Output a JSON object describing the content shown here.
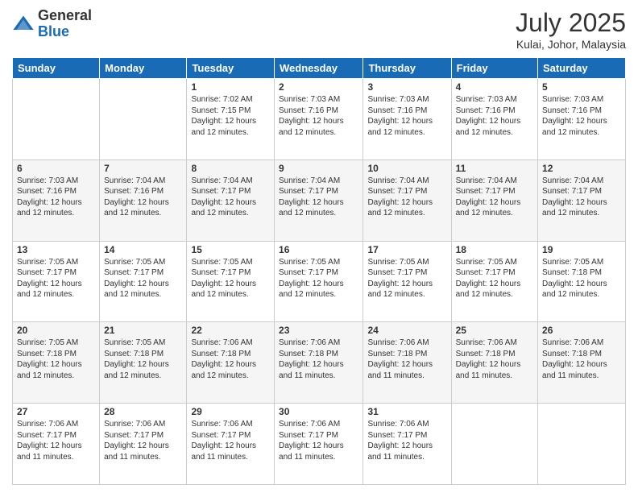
{
  "logo": {
    "general": "General",
    "blue": "Blue"
  },
  "title": "July 2025",
  "location": "Kulai, Johor, Malaysia",
  "days_of_week": [
    "Sunday",
    "Monday",
    "Tuesday",
    "Wednesday",
    "Thursday",
    "Friday",
    "Saturday"
  ],
  "weeks": [
    [
      {
        "day": "",
        "info": ""
      },
      {
        "day": "",
        "info": ""
      },
      {
        "day": "1",
        "info": "Sunrise: 7:02 AM\nSunset: 7:15 PM\nDaylight: 12 hours and 12 minutes."
      },
      {
        "day": "2",
        "info": "Sunrise: 7:03 AM\nSunset: 7:16 PM\nDaylight: 12 hours and 12 minutes."
      },
      {
        "day": "3",
        "info": "Sunrise: 7:03 AM\nSunset: 7:16 PM\nDaylight: 12 hours and 12 minutes."
      },
      {
        "day": "4",
        "info": "Sunrise: 7:03 AM\nSunset: 7:16 PM\nDaylight: 12 hours and 12 minutes."
      },
      {
        "day": "5",
        "info": "Sunrise: 7:03 AM\nSunset: 7:16 PM\nDaylight: 12 hours and 12 minutes."
      }
    ],
    [
      {
        "day": "6",
        "info": "Sunrise: 7:03 AM\nSunset: 7:16 PM\nDaylight: 12 hours and 12 minutes."
      },
      {
        "day": "7",
        "info": "Sunrise: 7:04 AM\nSunset: 7:16 PM\nDaylight: 12 hours and 12 minutes."
      },
      {
        "day": "8",
        "info": "Sunrise: 7:04 AM\nSunset: 7:17 PM\nDaylight: 12 hours and 12 minutes."
      },
      {
        "day": "9",
        "info": "Sunrise: 7:04 AM\nSunset: 7:17 PM\nDaylight: 12 hours and 12 minutes."
      },
      {
        "day": "10",
        "info": "Sunrise: 7:04 AM\nSunset: 7:17 PM\nDaylight: 12 hours and 12 minutes."
      },
      {
        "day": "11",
        "info": "Sunrise: 7:04 AM\nSunset: 7:17 PM\nDaylight: 12 hours and 12 minutes."
      },
      {
        "day": "12",
        "info": "Sunrise: 7:04 AM\nSunset: 7:17 PM\nDaylight: 12 hours and 12 minutes."
      }
    ],
    [
      {
        "day": "13",
        "info": "Sunrise: 7:05 AM\nSunset: 7:17 PM\nDaylight: 12 hours and 12 minutes."
      },
      {
        "day": "14",
        "info": "Sunrise: 7:05 AM\nSunset: 7:17 PM\nDaylight: 12 hours and 12 minutes."
      },
      {
        "day": "15",
        "info": "Sunrise: 7:05 AM\nSunset: 7:17 PM\nDaylight: 12 hours and 12 minutes."
      },
      {
        "day": "16",
        "info": "Sunrise: 7:05 AM\nSunset: 7:17 PM\nDaylight: 12 hours and 12 minutes."
      },
      {
        "day": "17",
        "info": "Sunrise: 7:05 AM\nSunset: 7:17 PM\nDaylight: 12 hours and 12 minutes."
      },
      {
        "day": "18",
        "info": "Sunrise: 7:05 AM\nSunset: 7:17 PM\nDaylight: 12 hours and 12 minutes."
      },
      {
        "day": "19",
        "info": "Sunrise: 7:05 AM\nSunset: 7:18 PM\nDaylight: 12 hours and 12 minutes."
      }
    ],
    [
      {
        "day": "20",
        "info": "Sunrise: 7:05 AM\nSunset: 7:18 PM\nDaylight: 12 hours and 12 minutes."
      },
      {
        "day": "21",
        "info": "Sunrise: 7:05 AM\nSunset: 7:18 PM\nDaylight: 12 hours and 12 minutes."
      },
      {
        "day": "22",
        "info": "Sunrise: 7:06 AM\nSunset: 7:18 PM\nDaylight: 12 hours and 12 minutes."
      },
      {
        "day": "23",
        "info": "Sunrise: 7:06 AM\nSunset: 7:18 PM\nDaylight: 12 hours and 11 minutes."
      },
      {
        "day": "24",
        "info": "Sunrise: 7:06 AM\nSunset: 7:18 PM\nDaylight: 12 hours and 11 minutes."
      },
      {
        "day": "25",
        "info": "Sunrise: 7:06 AM\nSunset: 7:18 PM\nDaylight: 12 hours and 11 minutes."
      },
      {
        "day": "26",
        "info": "Sunrise: 7:06 AM\nSunset: 7:18 PM\nDaylight: 12 hours and 11 minutes."
      }
    ],
    [
      {
        "day": "27",
        "info": "Sunrise: 7:06 AM\nSunset: 7:17 PM\nDaylight: 12 hours and 11 minutes."
      },
      {
        "day": "28",
        "info": "Sunrise: 7:06 AM\nSunset: 7:17 PM\nDaylight: 12 hours and 11 minutes."
      },
      {
        "day": "29",
        "info": "Sunrise: 7:06 AM\nSunset: 7:17 PM\nDaylight: 12 hours and 11 minutes."
      },
      {
        "day": "30",
        "info": "Sunrise: 7:06 AM\nSunset: 7:17 PM\nDaylight: 12 hours and 11 minutes."
      },
      {
        "day": "31",
        "info": "Sunrise: 7:06 AM\nSunset: 7:17 PM\nDaylight: 12 hours and 11 minutes."
      },
      {
        "day": "",
        "info": ""
      },
      {
        "day": "",
        "info": ""
      }
    ]
  ]
}
